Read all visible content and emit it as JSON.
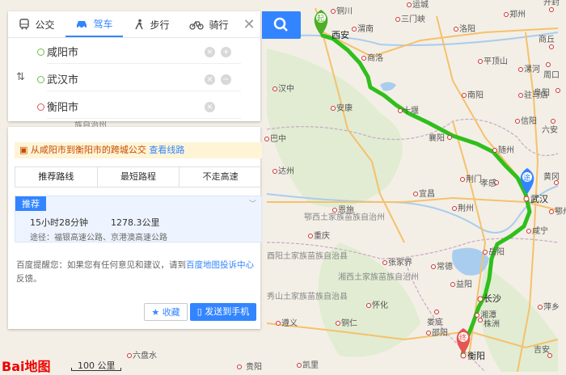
{
  "transport_tabs": [
    {
      "label": "公交",
      "icon": "bus-icon"
    },
    {
      "label": "驾车",
      "icon": "car-icon",
      "active": true
    },
    {
      "label": "步行",
      "icon": "walk-icon"
    },
    {
      "label": "骑行",
      "icon": "bike-icon"
    }
  ],
  "stops": {
    "origin": "咸阳市",
    "waypoint": "武汉市",
    "destination": "衡阳市"
  },
  "bus_tip": {
    "text": "从咸阳市到衡阳市的跨城公交",
    "link": "查看线路"
  },
  "route_options": [
    "推荐路线",
    "最短路程",
    "不走高速"
  ],
  "route": {
    "badge": "推荐",
    "duration": "15小时28分钟",
    "distance": "1278.3公里",
    "via": "途径：福银高速公路、京港澳高速公路"
  },
  "notice": {
    "prefix": "百度提醒您：如果您有任何意见和建议，请到",
    "link": "百度地图投诉中心",
    "suffix": "反馈。"
  },
  "buttons": {
    "favorite": "收藏",
    "send": "发送到手机"
  },
  "map": {
    "start_marker": "起",
    "via_marker": "途",
    "end_marker": "终",
    "cities": [
      "铜川",
      "运城",
      "洛阳",
      "郑州",
      "开封",
      "商丘",
      "西安",
      "渭南",
      "三门峡",
      "平顶山",
      "漯河",
      "周口",
      "阜阳",
      "商洛",
      "南阳",
      "驻马店",
      "汉中",
      "十堰",
      "安康",
      "信阳",
      "六安",
      "襄阳",
      "随州",
      "达州",
      "巴中",
      "孝感",
      "武汉",
      "黄冈",
      "鄂州",
      "宜昌",
      "荆门",
      "恩施",
      "荆州",
      "咸宁",
      "岳阳",
      "常德",
      "长沙",
      "张家界",
      "湘潭",
      "株洲",
      "娄底",
      "怀化",
      "邵阳",
      "衡阳",
      "遵义",
      "贵阳",
      "铜仁",
      "重庆",
      "益阳",
      "凯里",
      "萍乡",
      "吉安",
      "六盘水"
    ],
    "regions": [
      "族自治州",
      "鄂西土家族苗族自治州",
      "酉阳土家族苗族自治县",
      "湘西土家族苗族自治州",
      "秀山土家族苗族自治县"
    ],
    "scale": "100 公里",
    "logo": "Bai地图"
  },
  "colors": {
    "route": "#2fbf1c",
    "accent": "#3385ff",
    "tip_bg": "#fff4d6"
  }
}
